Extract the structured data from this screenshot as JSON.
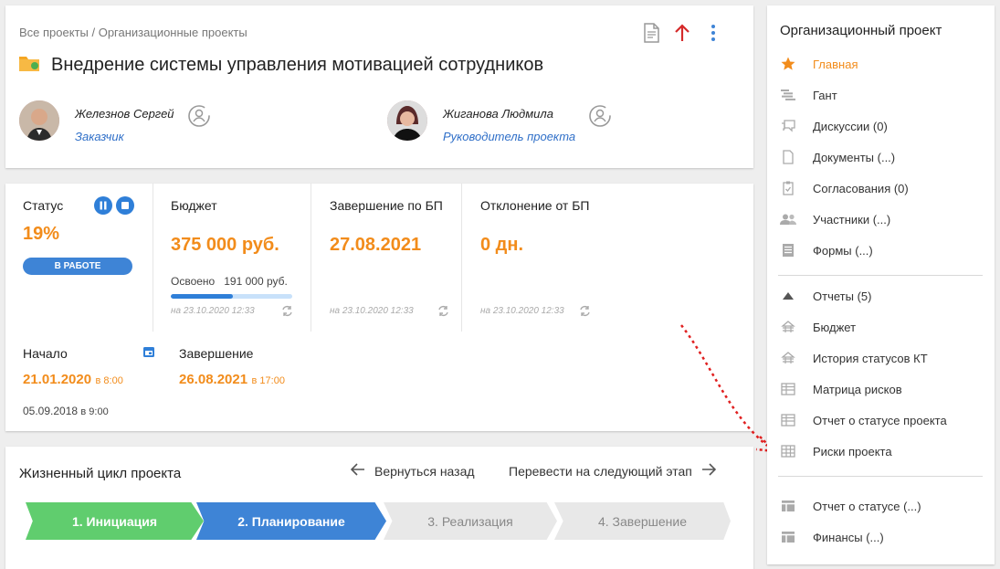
{
  "header": {
    "breadcrumb": "Все проекты / Организационные проекты",
    "title": "Внедрение системы управления мотивацией сотрудников",
    "customer": {
      "name": "Железнов Сергей",
      "role": "Заказчик"
    },
    "manager": {
      "name": "Жиганова Людмила",
      "role": "Руководитель проекта"
    }
  },
  "stats": {
    "status": {
      "label": "Статус",
      "value": "19%",
      "badge": "В РАБОТЕ"
    },
    "budget": {
      "label": "Бюджет",
      "value": "375 000 руб.",
      "spent_label": "Освоено",
      "spent_value": "191 000 руб.",
      "spent_fraction": 0.51,
      "updated": "на 23.10.2020 12:33"
    },
    "finish_plan": {
      "label": "Завершение по БП",
      "value": "27.08.2021",
      "updated": "на 23.10.2020 12:33"
    },
    "deviation": {
      "label": "Отклонение от БП",
      "value": "0 дн.",
      "updated": "на 23.10.2020 12:33"
    },
    "start": {
      "label": "Начало",
      "date": "21.01.2020",
      "time": "в 8:00",
      "orig_date": "05.09.2018",
      "orig_time": "в 9:00"
    },
    "end": {
      "label": "Завершение",
      "date": "26.08.2021",
      "time": "в 17:00"
    }
  },
  "lifecycle": {
    "title": "Жизненный цикл проекта",
    "back": "Вернуться назад",
    "next": "Перевести на следующий этап",
    "stages": [
      "1. Инициация",
      "2. Планирование",
      "3. Реализация",
      "4. Завершение"
    ]
  },
  "sidebar": {
    "title": "Организационный проект",
    "items": [
      {
        "label": "Главная",
        "icon": "star-icon",
        "active": true
      },
      {
        "label": "Гант",
        "icon": "gantt-icon"
      },
      {
        "label": "Дискуссии (0)",
        "icon": "chat-icon"
      },
      {
        "label": "Документы (...)",
        "icon": "document-icon"
      },
      {
        "label": "Согласования (0)",
        "icon": "clipboard-icon"
      },
      {
        "label": "Участники (...)",
        "icon": "people-icon"
      },
      {
        "label": "Формы (...)",
        "icon": "form-icon"
      }
    ],
    "reports": {
      "label": "Отчеты",
      "count": "(5)"
    },
    "report_items": [
      {
        "label": "Бюджет",
        "icon": "report-icon"
      },
      {
        "label": "История статусов КТ",
        "icon": "report-icon"
      },
      {
        "label": "Матрица рисков",
        "icon": "table-icon"
      },
      {
        "label": "Отчет о статусе проекта",
        "icon": "table-icon"
      },
      {
        "label": "Риски проекта",
        "icon": "grid-icon"
      }
    ],
    "bottom_items": [
      {
        "label": "Отчет о статусе (...)",
        "icon": "table-plus-icon"
      },
      {
        "label": "Финансы (...)",
        "icon": "table-plus-icon"
      }
    ]
  },
  "colors": {
    "accent": "#f28c1b",
    "primary": "#3e84d6",
    "green": "#60cd6e",
    "annotation": "#e02020"
  }
}
